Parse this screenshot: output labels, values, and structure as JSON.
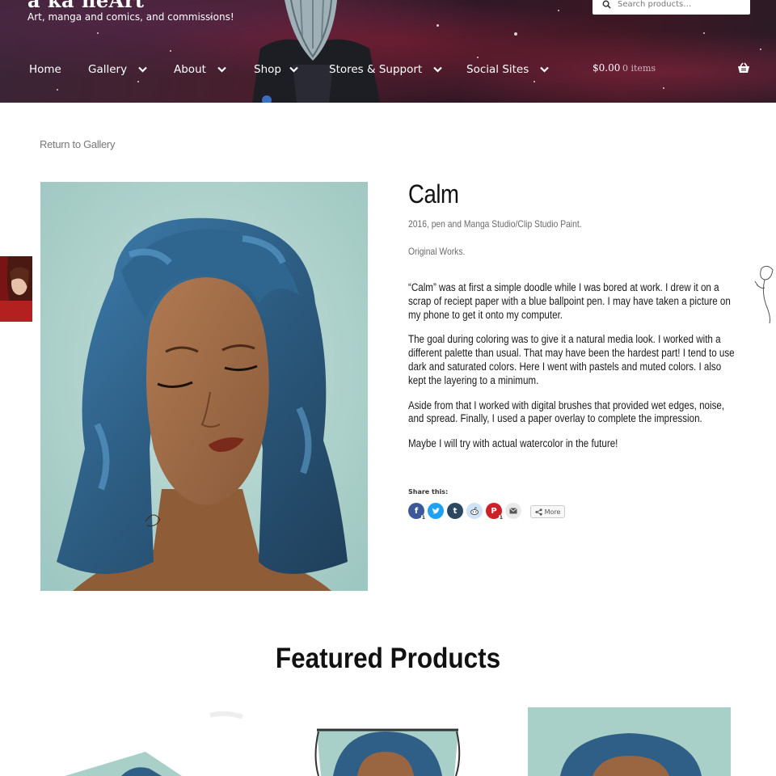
{
  "site": {
    "title": "a ka neArt",
    "tagline": "Art, manga and comics, and commissions!"
  },
  "search": {
    "placeholder": "Search products…"
  },
  "nav": {
    "items": [
      {
        "label": "Home",
        "has_dropdown": false
      },
      {
        "label": "Gallery",
        "has_dropdown": true
      },
      {
        "label": "About",
        "has_dropdown": true
      },
      {
        "label": "Shop",
        "has_dropdown": true
      },
      {
        "label": "Stores & Support",
        "has_dropdown": true
      },
      {
        "label": "Social Sites",
        "has_dropdown": true
      }
    ]
  },
  "cart": {
    "amount": "$0.00",
    "count": "0 items",
    "icon": "basket-icon"
  },
  "page": {
    "return_link": "Return to Gallery",
    "art_title": "Calm",
    "meta_line1": "2016, pen and Manga Studio/Clip Studio Paint.",
    "meta_line2": "Original Works.",
    "paragraphs": [
      "“Calm” was at first a simple doodle while I was bored at work.  I drew it on a scrap of reciept paper with a blue ballpoint pen.  I may have taken a picture on my phone to get it onto my computer.",
      "The goal during coloring was to give it a natural media look.  I worked with a different palette than usual.  That may have been the hardest part!  I tend to use dark and saturated colors.  Here I went with pastels and muted colors.  I also kept the layering to a minimum.",
      "Aside from that I worked with digital brushes that provided wet edges, noise, and spread.  Finally, I used a paper overlay to complete the impression.",
      "Maybe I will try with actual watercolor in the future!"
    ]
  },
  "share": {
    "label": "Share this:",
    "buttons": [
      {
        "name": "facebook-icon",
        "color": "#3b5998",
        "count": "1"
      },
      {
        "name": "twitter-icon",
        "color": "#1da1f2",
        "count": ""
      },
      {
        "name": "tumblr-icon",
        "color": "#2c4762",
        "count": ""
      },
      {
        "name": "reddit-icon",
        "color": "#cee3f8",
        "count": ""
      },
      {
        "name": "pinterest-icon",
        "color": "#cc2127",
        "count": "1"
      },
      {
        "name": "email-icon",
        "color": "#e9e9e9",
        "count": ""
      }
    ],
    "more_label": "More"
  },
  "featured": {
    "title": "Featured Products"
  },
  "colors": {
    "header_bg": "#3a1d2b",
    "artwork_bg": "#a9cfc9",
    "hair": "#2f5f86",
    "skin": "#9a6642"
  }
}
